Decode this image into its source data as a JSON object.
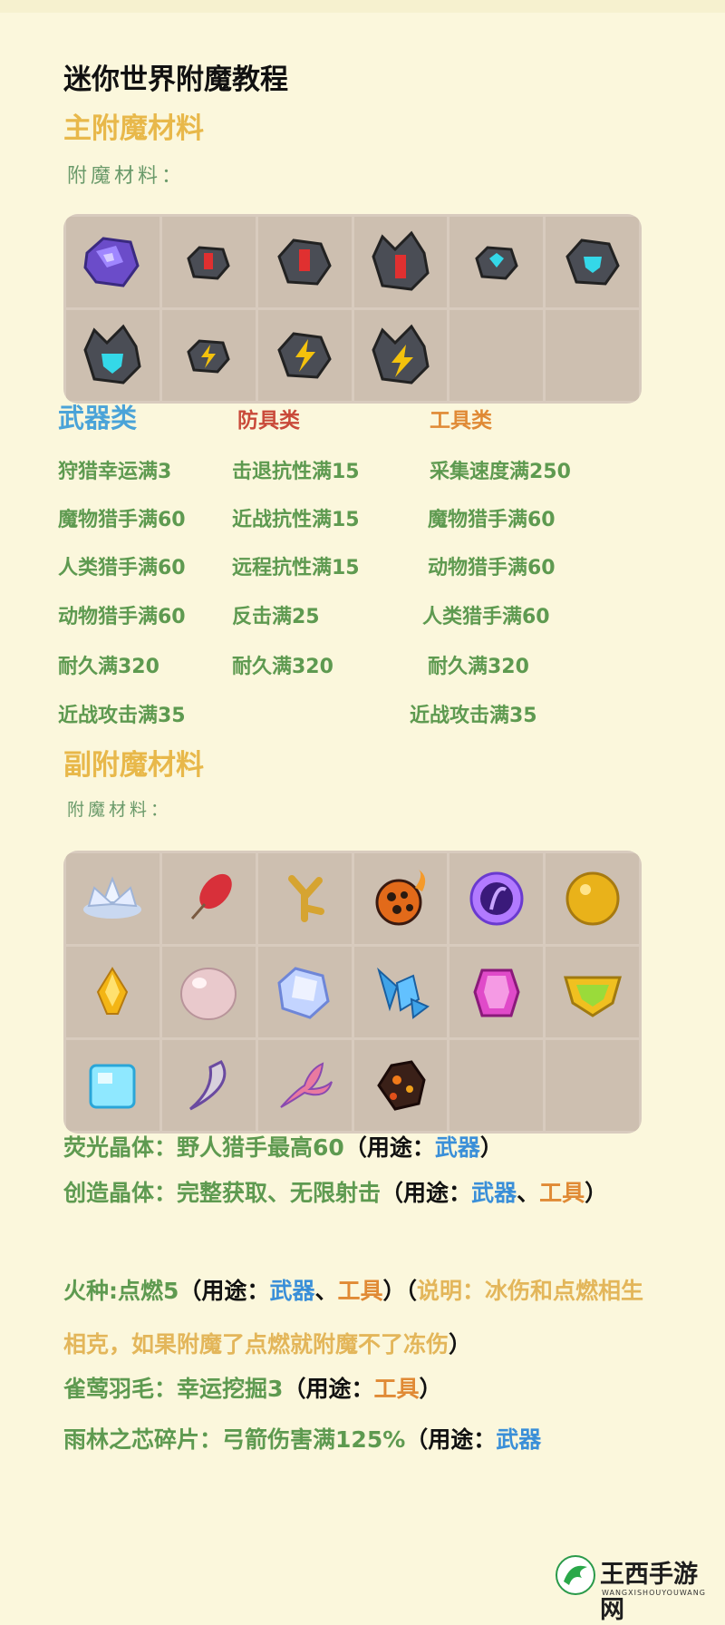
{
  "title": "迷你世界附魔教程",
  "main_section": {
    "heading": "主附魔材料",
    "label": "附魔材料：",
    "materials_icons": [
      "purple-crystal-stone",
      "red-rune-stone-small",
      "red-rune-stone",
      "red-rune-stone-large",
      "cyan-rune-stone-small",
      "cyan-rune-stone",
      "cyan-rune-stone-large",
      "yellow-rune-stone-small",
      "yellow-rune-stone",
      "yellow-rune-stone-large"
    ]
  },
  "categories": {
    "weapon": {
      "name": "武器类",
      "color": "#4aa3d8",
      "items": [
        "狩猎幸运满3",
        "魔物猎手满60",
        "人类猎手满60",
        "动物猎手满60",
        "耐久满320",
        "近战攻击满35"
      ]
    },
    "armor": {
      "name": "防具类",
      "color": "#c94a3a",
      "items": [
        "击退抗性满15",
        "近战抗性满15",
        "远程抗性满15",
        "反击满25",
        "耐久满320"
      ]
    },
    "tool": {
      "name": "工具类",
      "color": "#e08a35",
      "items": [
        "采集速度满250",
        "魔物猎手满60",
        "动物猎手满60",
        "人类猎手满60",
        "耐久满320",
        "近战攻击满35"
      ]
    }
  },
  "sub_section": {
    "heading": "副附魔材料",
    "label": "附魔材料：",
    "materials_icons": [
      "white-lotus",
      "red-feather",
      "wooden-branch",
      "fire-spore",
      "purple-orb",
      "golden-orb",
      "yellow-gem",
      "pearl-orb",
      "blue-crystal",
      "ice-crystal-cluster",
      "pink-crystal",
      "green-gem-badge",
      "ice-cube",
      "curved-horn",
      "fish-tail",
      "lava-rock"
    ]
  },
  "descriptions": {
    "p1": {
      "name": "荧光晶体",
      "sep": "：",
      "effect": "野人猎手最高60",
      "open": "（用途：",
      "use1": "武器",
      "close": "）"
    },
    "p2": {
      "name": "创造晶体",
      "sep": "：",
      "effect": "完整获取、无限射击",
      "open": "（用途：",
      "use1": "武器",
      "dot": "、",
      "use2": "工具",
      "close": "）"
    },
    "p3": {
      "name": "火种",
      "sep": ":",
      "effect": "点燃5",
      "open": "（用途：",
      "use1": "武器",
      "dot": "、",
      "use2": "工具",
      "close": "）",
      "note_open": "（",
      "note_label": "说明：",
      "note_text": "冰伤和点燃相生相克，如果附魔了点燃就附魔不了冻伤",
      "note_close": "）"
    },
    "p4": {
      "name": "雀莺羽毛",
      "sep": "：",
      "effect": "幸运挖掘3",
      "open": "（用途：",
      "use1": "工具",
      "close": "）"
    },
    "p5": {
      "name": "雨林之芯碎片",
      "sep": "：",
      "effect": "弓箭伤害满125%",
      "open": "（用途：",
      "use1": "武器"
    }
  },
  "watermark": {
    "name": "王西手游网",
    "domain": "WANGXISHOUYOUWANG"
  }
}
